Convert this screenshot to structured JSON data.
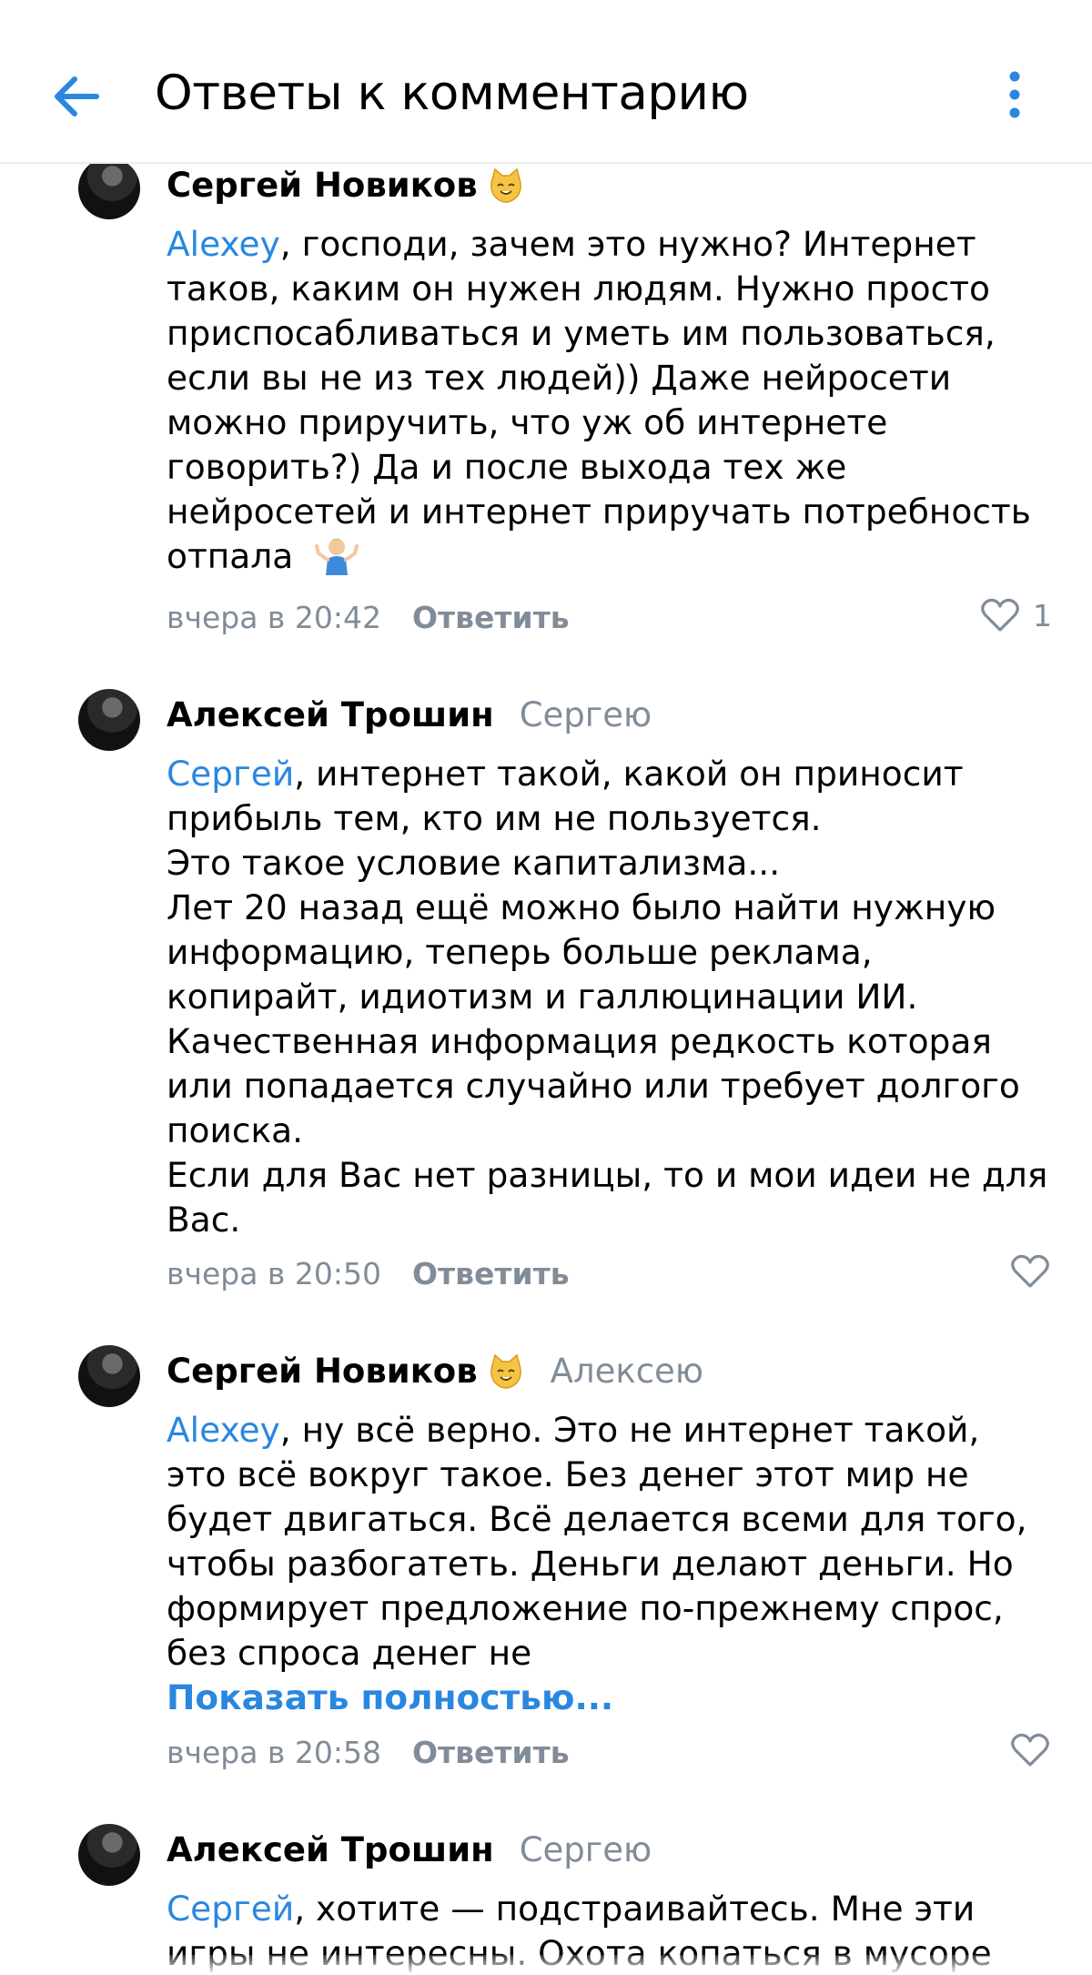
{
  "header": {
    "title": "Ответы к комментарию",
    "back_icon": "arrow-left-icon",
    "menu_icon": "more-vertical-icon",
    "accent_color": "#2a87e0"
  },
  "comments": [
    {
      "author": "Сергей Новиков",
      "author_badge": "cat-emoji",
      "reply_to": "",
      "mention": "Alexey",
      "text_lines": [
        ", господи, зачем это нужно? Интернет",
        "таков, каким он нужен людям. Нужно просто",
        "приспосабливаться и уметь им пользоваться,",
        "если вы не из тех людей)) Даже нейросети",
        "можно приручить, что уж об интернете",
        "говорить?) Да и после выхода тех же",
        "нейросетей и интернет приручать потребность",
        "отпала"
      ],
      "trailing_emoji": "person-shrugging-emoji",
      "time": "вчера в 20:42",
      "reply_label": "Ответить",
      "likes": "1"
    },
    {
      "author": "Алексей Трошин",
      "reply_to": "Сергею",
      "mention": "Сергей",
      "text_lines": [
        ", интернет такой, какой он приносит",
        "прибыль тем, кто им не пользуется.",
        "Это такое условие капитализма...",
        "Лет 20 назад ещё можно было найти нужную",
        "информацию, теперь больше реклама,",
        "копирайт, идиотизм и галлюцинации ИИ.",
        "Качественная информация редкость которая",
        "или попадается случайно или требует долгого",
        "поиска.",
        "Если для Вас нет разницы, то и мои идеи не для",
        "Вас."
      ],
      "time": "вчера в 20:50",
      "reply_label": "Ответить"
    },
    {
      "author": "Сергей Новиков",
      "author_badge": "cat-emoji",
      "reply_to": "Алексею",
      "mention": "Alexey",
      "text_lines": [
        ", ну всё верно. Это не интернет такой,",
        "это всё вокруг такое. Без денег этот мир не",
        "будет двигаться. Всё делается всеми для того,",
        "чтобы разбогатеть. Деньги делают деньги. Но",
        "формирует предложение по-прежнему спрос,",
        "без спроса денег не"
      ],
      "show_more": "Показать полностью...",
      "time": "вчера в 20:58",
      "reply_label": "Ответить"
    },
    {
      "author": "Алексей Трошин",
      "reply_to": "Сергею",
      "mention": "Сергей",
      "text_lines": [
        ", хотите — подстраивайтесь. Мне эти",
        "игры не интересны. Охота копаться в мусоре"
      ]
    }
  ]
}
